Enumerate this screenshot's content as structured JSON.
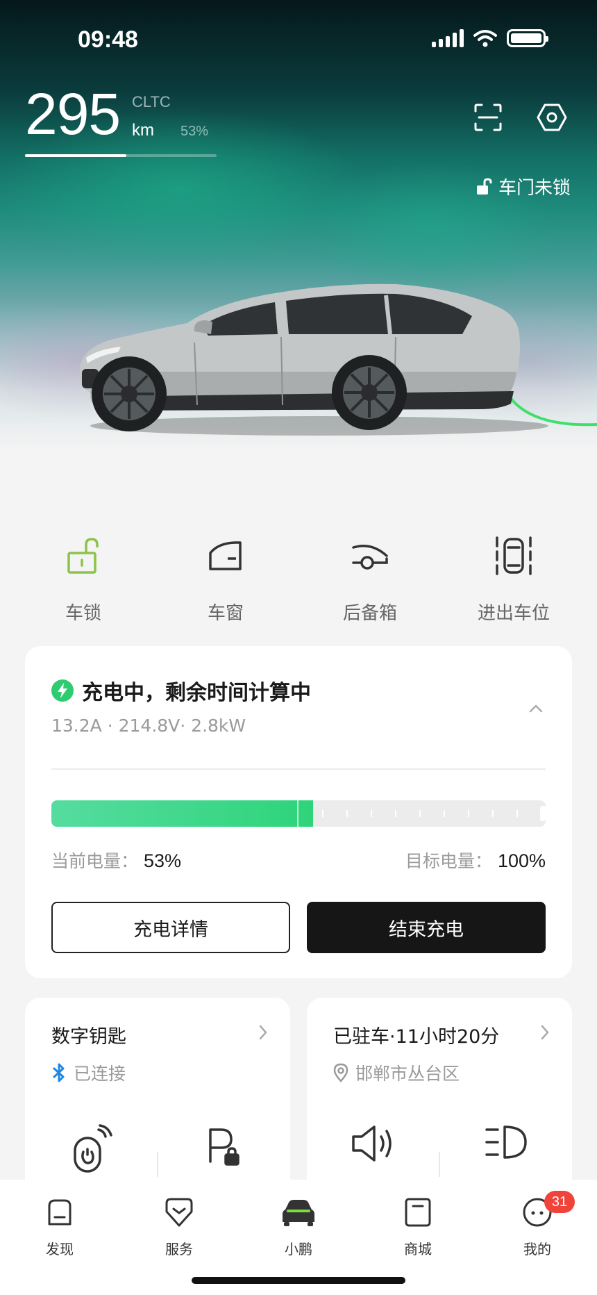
{
  "status_bar": {
    "time": "09:48"
  },
  "range": {
    "value": "295",
    "standard": "CLTC",
    "unit": "km",
    "battery_percent_text": "53%",
    "battery_fraction": 0.53
  },
  "door_status": "车门未锁",
  "quick_actions": [
    {
      "label": "车锁",
      "icon": "unlock-icon"
    },
    {
      "label": "车窗",
      "icon": "car-window-icon"
    },
    {
      "label": "后备箱",
      "icon": "trunk-icon"
    },
    {
      "label": "进出车位",
      "icon": "parking-maneuver-icon"
    }
  ],
  "charging": {
    "title": "充电中，剩余时间计算中",
    "details": "13.2A · 214.8V· 2.8kW",
    "current_soc_label": "当前电量：",
    "current_soc": "53%",
    "target_soc_label": "目标电量：",
    "target_soc": "100%",
    "progress_fraction": 0.53,
    "details_button": "充电详情",
    "stop_button": "结束充电"
  },
  "digital_key": {
    "title": "数字钥匙",
    "status": "已连接"
  },
  "parking": {
    "title": "已驻车·11小时20分",
    "location": "邯郸市丛台区"
  },
  "tabs": [
    {
      "label": "发现",
      "icon": "discover-icon"
    },
    {
      "label": "服务",
      "icon": "service-icon"
    },
    {
      "label": "小鹏",
      "icon": "car-icon"
    },
    {
      "label": "商城",
      "icon": "shop-icon"
    },
    {
      "label": "我的",
      "icon": "profile-icon",
      "badge": "31"
    }
  ],
  "colors": {
    "accent_green": "#2ed47a",
    "lock_green": "#8bc34a",
    "badge_red": "#f0433a",
    "bluetooth_blue": "#1e88e5"
  }
}
